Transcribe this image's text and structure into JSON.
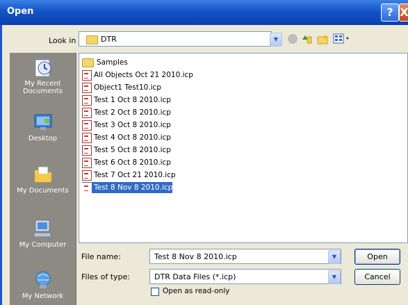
{
  "window": {
    "title": "Open",
    "help_button": "?",
    "close_button": "X"
  },
  "toolbar": {
    "lookin_label": "Look in",
    "lookin_value": "DTR"
  },
  "places": [
    {
      "label": "My Recent Documents",
      "icon": "recent-documents-icon"
    },
    {
      "label": "Desktop",
      "icon": "desktop-icon"
    },
    {
      "label": "My Documents",
      "icon": "my-documents-icon"
    },
    {
      "label": "My Computer",
      "icon": "my-computer-icon"
    },
    {
      "label": "My Network",
      "icon": "my-network-icon"
    }
  ],
  "files": [
    {
      "name": "Samples",
      "type": "folder"
    },
    {
      "name": "All Objects Oct 21 2010.icp",
      "type": "file"
    },
    {
      "name": "Object1 Test10.icp",
      "type": "file"
    },
    {
      "name": "Test 1 Oct 8 2010.icp",
      "type": "file"
    },
    {
      "name": "Test 2 Oct 8 2010.icp",
      "type": "file"
    },
    {
      "name": "Test 3 Oct 8 2010.icp",
      "type": "file"
    },
    {
      "name": "Test 4 Oct 8 2010.icp",
      "type": "file"
    },
    {
      "name": "Test 5 Oct 8 2010.icp",
      "type": "file"
    },
    {
      "name": "Test 6 Oct 8 2010.icp",
      "type": "file"
    },
    {
      "name": "Test 7 Oct 21 2010.icp",
      "type": "file"
    },
    {
      "name": "Test 8 Nov 8 2010.icp",
      "type": "file",
      "selected": true
    }
  ],
  "form": {
    "filename_label": "File name:",
    "filename_value": "Test 8 Nov 8 2010.icp",
    "filetype_label": "Files of type:",
    "filetype_value": "DTR Data Files (*.icp)",
    "readonly_label": "Open as read-only",
    "open_button": "Open",
    "cancel_button": "Cancel"
  },
  "colors": {
    "titlebar": "#1453c5",
    "selection": "#316ac5",
    "dialog_bg": "#ece9d8",
    "places_bg": "#8c8a83"
  }
}
